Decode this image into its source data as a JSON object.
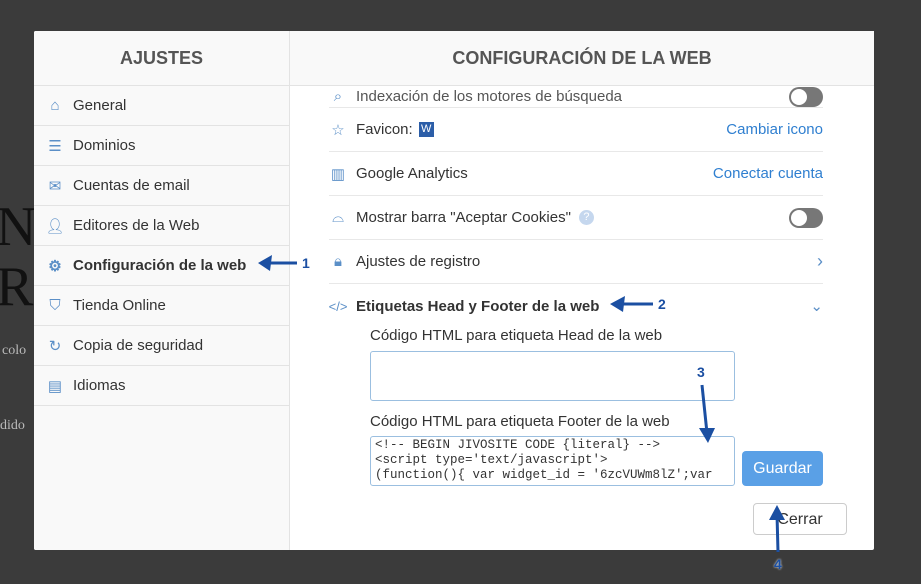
{
  "background": {
    "fragments": [
      "N",
      "R",
      "colo",
      "dido"
    ]
  },
  "sidebar": {
    "title": "AJUSTES",
    "items": [
      {
        "label": "General",
        "icon": "home-icon"
      },
      {
        "label": "Dominios",
        "icon": "database-icon"
      },
      {
        "label": "Cuentas de email",
        "icon": "mail-icon"
      },
      {
        "label": "Editores de la Web",
        "icon": "user-icon"
      },
      {
        "label": "Configuración de la web",
        "icon": "gear-icon",
        "active": true
      },
      {
        "label": "Tienda Online",
        "icon": "bag-icon"
      },
      {
        "label": "Copia de seguridad",
        "icon": "refresh-icon"
      },
      {
        "label": "Idiomas",
        "icon": "language-icon"
      }
    ]
  },
  "main": {
    "title": "CONFIGURACIÓN DE LA WEB",
    "rows": {
      "indexing": "Indexación de los motores de búsqueda",
      "favicon": "Favicon:",
      "favicon_badge": "W",
      "favicon_action": "Cambiar icono",
      "analytics": "Google Analytics",
      "analytics_action": "Conectar cuenta",
      "cookies": "Mostrar barra \"Aceptar Cookies\"",
      "help": "?",
      "registro": "Ajustes de registro",
      "tags": "Etiquetas Head y Footer de la web"
    },
    "head_label": "Código HTML para etiqueta Head de la web",
    "head_value": "",
    "footer_label": "Código HTML para etiqueta Footer de la web",
    "footer_value": "<!-- BEGIN JIVOSITE CODE {literal} -->\n<script type='text/javascript'>\n(function(){ var widget_id = '6zcVUWm8lZ';var",
    "save": "Guardar",
    "close": "Cerrar"
  },
  "annotations": [
    "1",
    "2",
    "3",
    "4"
  ],
  "colors": {
    "accent": "#2f7fd0",
    "button": "#5aa0e6",
    "annotation": "#1b4fa2"
  }
}
